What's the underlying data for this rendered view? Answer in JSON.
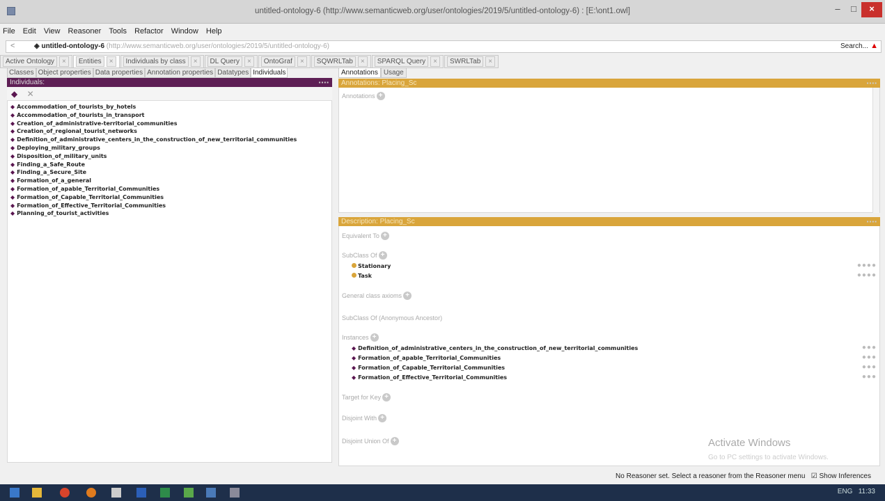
{
  "window": {
    "title": "untitled-ontology-6 (http://www.semanticweb.org/user/ontologies/2019/5/untitled-ontology-6) : [E:\\ont1.owl]",
    "minimize": "–",
    "maximize": "□",
    "close": "×"
  },
  "menu": [
    "File",
    "Edit",
    "View",
    "Reasoner",
    "Tools",
    "Refactor",
    "Window",
    "Help"
  ],
  "address": {
    "back": "<",
    "ontology": "untitled-ontology-6",
    "iri": "(http://www.semanticweb.org/user/ontologies/2019/5/untitled-ontology-6)",
    "search": "Search...",
    "warning": "▲"
  },
  "main_tabs": [
    "Active Ontology",
    "Entities",
    "Individuals by class",
    "DL Query",
    "OntoGraf",
    "SQWRLTab",
    "SPARQL Query",
    "SWRLTab"
  ],
  "entity_tabs": [
    "Classes",
    "Object properties",
    "Data properties",
    "Annotation properties",
    "Datatypes",
    "Individuals"
  ],
  "individuals": {
    "header": "Individuals:",
    "items": [
      "Accommodation_of_tourists_by_hotels",
      "Accommodation_of_tourists_in_transport",
      "Creation_of_administrative-territorial_communities",
      "Creation_of_regional_tourist_networks",
      "Definition_of_administrative_centers_in_the_construction_of_new_territorial_communities",
      "Deploying_military_groups",
      "Disposition_of_military_units",
      "Finding_a_Safe_Route",
      "Finding_a_Secure_Site",
      "Formation_of_a_general",
      "Formation_of_apable_Territorial_Communities",
      "Formation_of_Capable_Territorial_Communities",
      "Formation_of_Effective_Territorial_Communities",
      "Planning_of_tourist_activities"
    ]
  },
  "right_tabs": [
    "Annotations",
    "Usage"
  ],
  "annotations": {
    "header": "Annotations: Placing_Sc",
    "label": "Annotations"
  },
  "description": {
    "header": "Description: Placing_Sc",
    "equivalent_to": "Equivalent To",
    "subclass_of": "SubClass Of",
    "superclasses": [
      "Stationary",
      "Task"
    ],
    "general_axioms": "General class axioms",
    "subclass_anon": "SubClass Of (Anonymous Ancestor)",
    "instances_label": "Instances",
    "instances": [
      "Definition_of_administrative_centers_in_the_construction_of_new_territorial_communities",
      "Formation_of_apable_Territorial_Communities",
      "Formation_of_Capable_Territorial_Communities",
      "Formation_of_Effective_Territorial_Communities"
    ],
    "target_key": "Target for Key",
    "disjoint_with": "Disjoint With",
    "disjoint_union": "Disjoint Union Of"
  },
  "watermark": {
    "title": "Activate Windows",
    "sub": "Go to PC settings to activate Windows."
  },
  "status": {
    "message": "No Reasoner set. Select a reasoner from the Reasoner menu",
    "show_inferences": "Show Inferences"
  },
  "taskbar": {
    "lang": "ENG",
    "time": "11:33"
  }
}
